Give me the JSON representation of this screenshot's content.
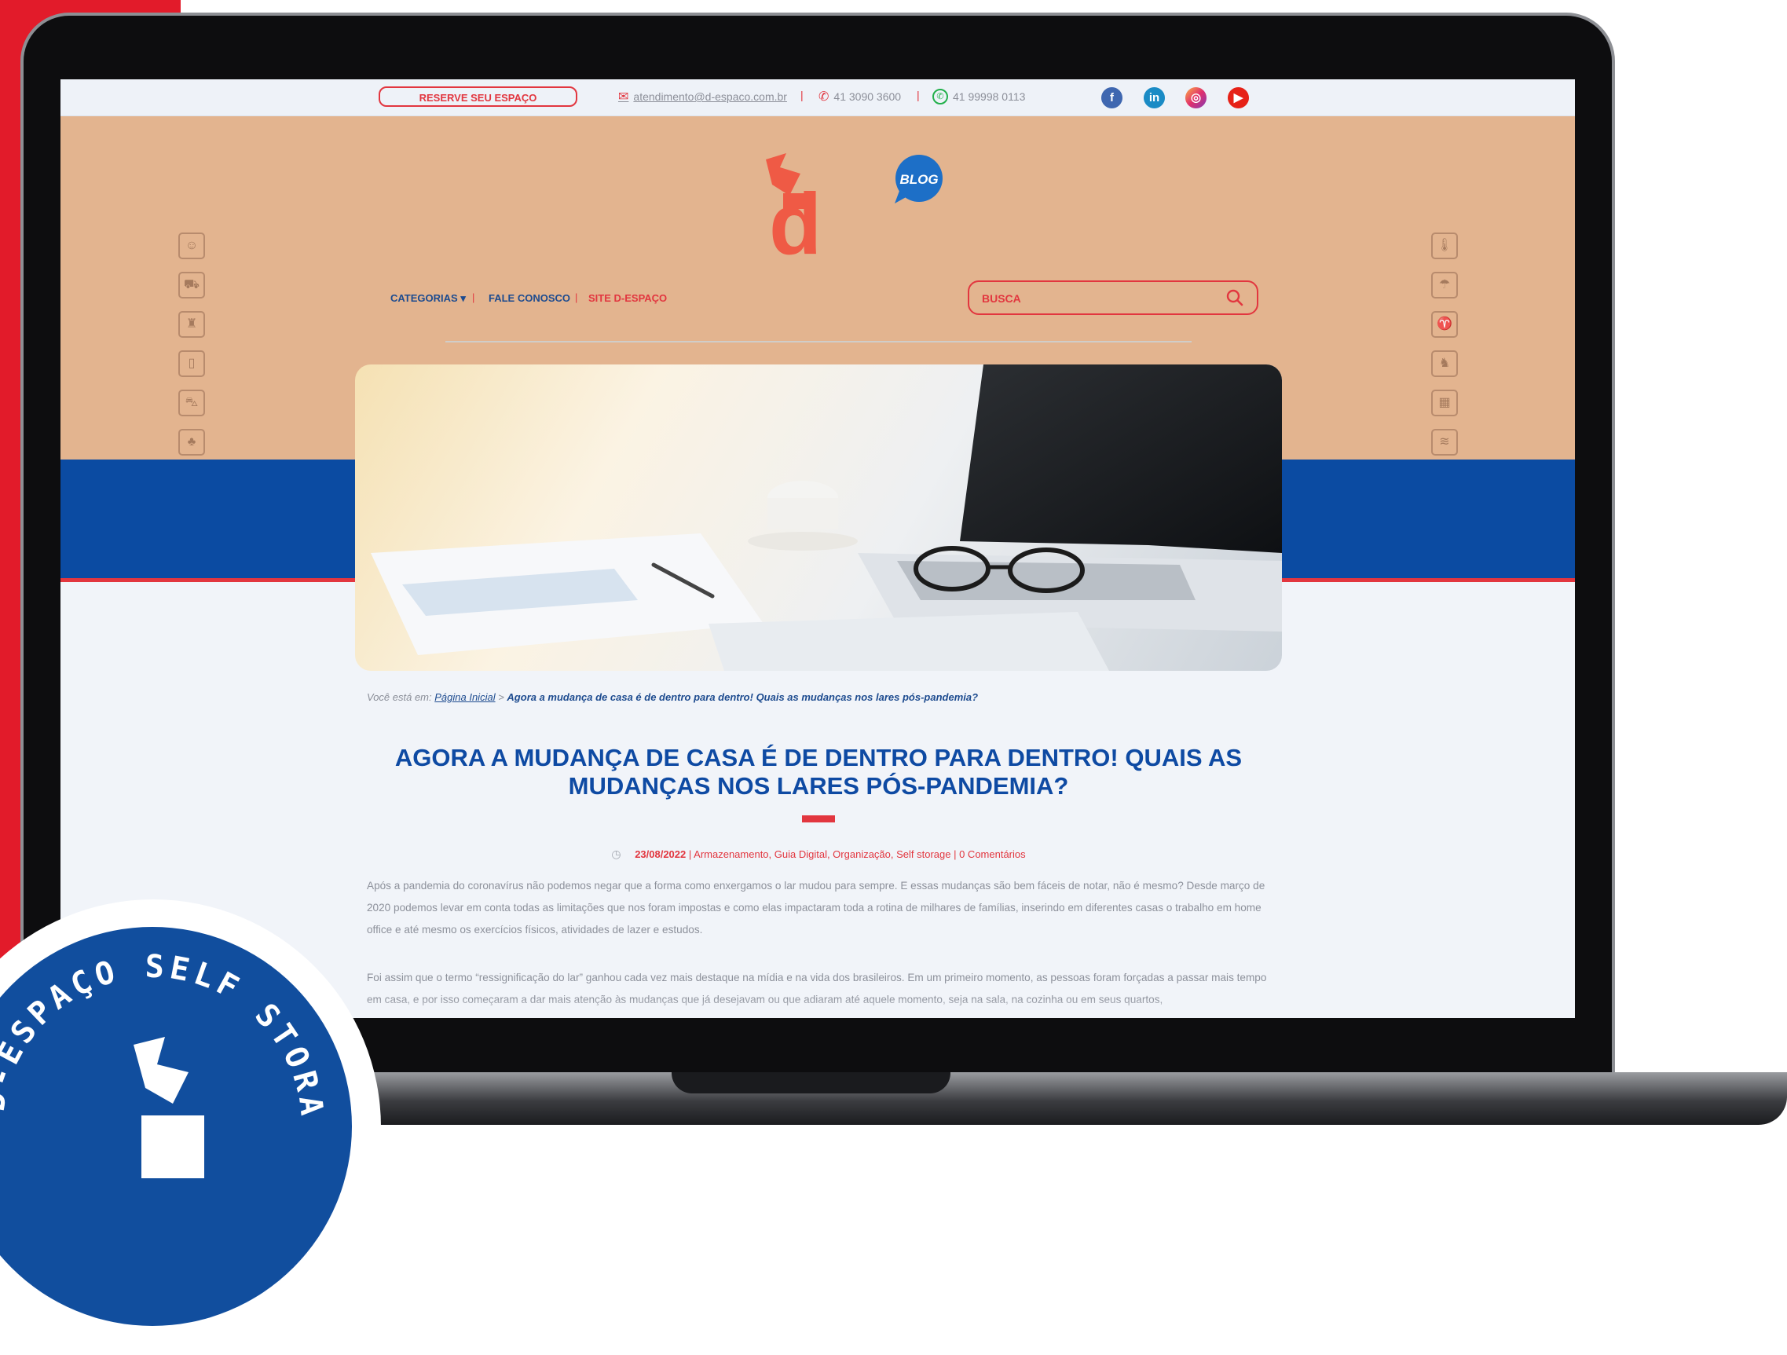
{
  "topbar": {
    "reserve_label": "RESERVE SEU ESPAÇO",
    "email": "atendimento@d-espaco.com.br",
    "phone": "41 3090 3600",
    "whatsapp": "41 99998 0113",
    "separator": "|",
    "social": [
      {
        "name": "facebook",
        "glyph": "f"
      },
      {
        "name": "linkedin",
        "glyph": "in"
      },
      {
        "name": "instagram",
        "glyph": "◎"
      },
      {
        "name": "youtube",
        "glyph": "▶"
      }
    ]
  },
  "header": {
    "logo_letter": "d",
    "blog_badge": "BLOG"
  },
  "nav": {
    "categorias": "CATEGORIAS ▾",
    "fale": "FALE CONOSCO",
    "site": "SITE D-ESPAÇO",
    "search_placeholder": "BUSCA"
  },
  "breadcrumb": {
    "prefix": "Você está em:",
    "home": "Página Inicial",
    "separator": ">",
    "current": "Agora a mudança de casa é de dentro para dentro! Quais as mudanças nos lares pós-pandemia?"
  },
  "post": {
    "title": "AGORA A MUDANÇA DE CASA É DE DENTRO PARA DENTRO! QUAIS AS MUDANÇAS NOS LARES PÓS-PANDEMIA?",
    "date": "23/08/2022",
    "categories": "| Armazenamento, Guia Digital, Organização, Self storage | 0 Comentários",
    "paragraph1": "Após a pandemia do coronavírus não podemos negar que a forma como enxergamos o lar mudou para sempre. E essas mudanças são bem fáceis de notar, não é mesmo? Desde março de 2020 podemos levar em conta todas as limitações que nos foram impostas e como elas impactaram toda a rotina de milhares de famílias, inserindo em diferentes casas o trabalho em home office e até mesmo os exercícios físicos, atividades de lazer e estudos.",
    "paragraph2": "Foi assim que o termo “ressignificação do lar” ganhou cada vez mais destaque na mídia e na vida dos brasileiros. Em um primeiro momento, as pessoas foram forçadas a passar mais tempo em casa, e por isso começaram a dar mais atenção às mudanças que já desejavam ou que adiaram até aquele momento, seja na sala, na cozinha ou em seus quartos,"
  },
  "seal": {
    "text": "D-ESPAÇO SELF STORAGE"
  },
  "colors": {
    "brand_red": "#e2363f",
    "brand_blue": "#0e4aa3",
    "kraft": "#e3b48f"
  }
}
